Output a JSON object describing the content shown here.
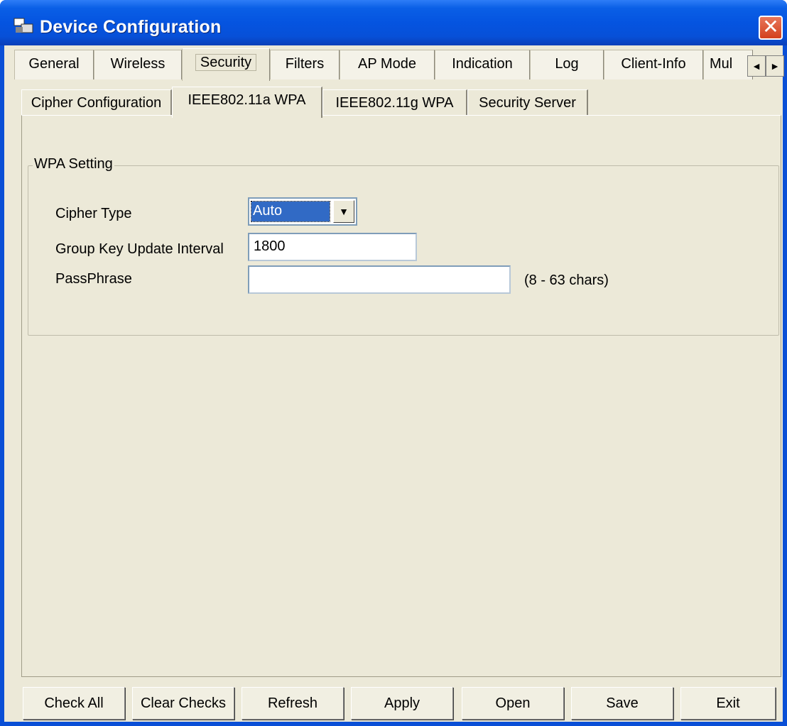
{
  "window": {
    "title": "Device Configuration",
    "close": "✕"
  },
  "main_tabs": [
    "General",
    "Wireless",
    "Security",
    "Filters",
    "AP Mode",
    "Indication",
    "Log",
    "Client-Info",
    "Mul"
  ],
  "scroll": {
    "left": "◄",
    "right": "►"
  },
  "sub_tabs": [
    "Cipher Configuration",
    "IEEE802.11a WPA",
    "IEEE802.11g WPA",
    "Security Server"
  ],
  "wpa": {
    "group_title": "WPA Setting",
    "cipher_type_label": "Cipher Type",
    "cipher_type_value": "Auto",
    "dropdown_arrow": "▼",
    "group_key_label": "Group Key Update Interval",
    "group_key_value": "1800",
    "passphrase_label": "PassPhrase",
    "passphrase_value": "",
    "passphrase_hint": "(8 - 63 chars)"
  },
  "buttons": [
    "Check All",
    "Clear Checks",
    "Refresh",
    "Apply",
    "Open",
    "Save",
    "Exit"
  ],
  "colors": {
    "titlebar": "#0554e0",
    "close": "#d3401d",
    "selection": "#316ac5",
    "face": "#ece9d8"
  }
}
